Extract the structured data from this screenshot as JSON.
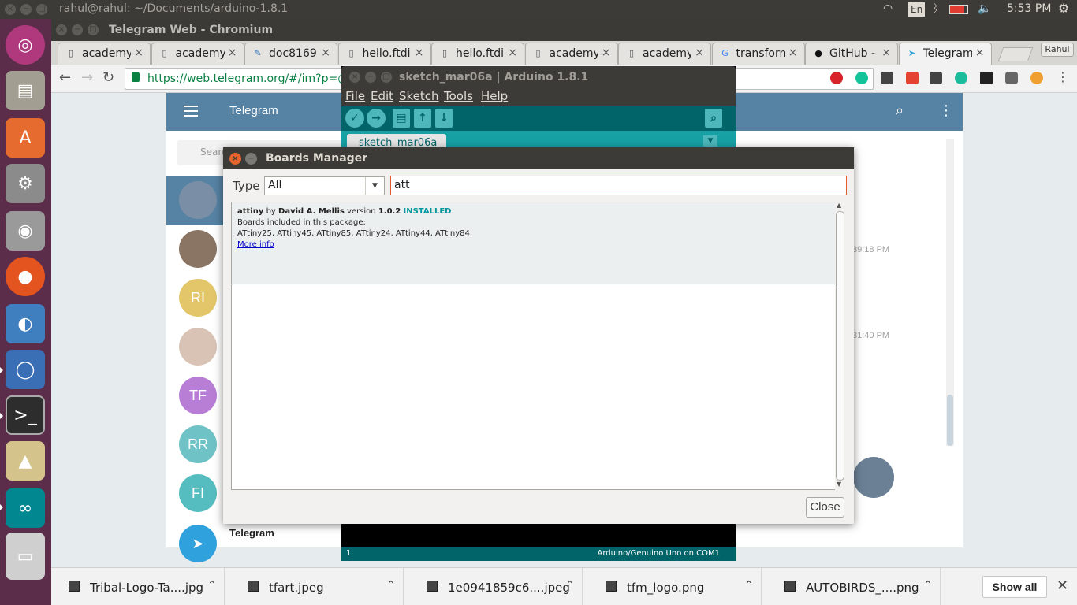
{
  "os": {
    "window_title": "rahul@rahul: ~/Documents/arduino-1.8.1",
    "keyboard": "En",
    "clock": "5:53 PM"
  },
  "browser": {
    "window_title": "Telegram Web - Chromium",
    "tabs": [
      {
        "label": "academy",
        "icon": "doc"
      },
      {
        "label": "academy",
        "icon": "doc"
      },
      {
        "label": "doc8169",
        "icon": "pen"
      },
      {
        "label": "hello.ftdi",
        "icon": "doc"
      },
      {
        "label": "hello.ftdi",
        "icon": "doc"
      },
      {
        "label": "academy",
        "icon": "doc"
      },
      {
        "label": "academy",
        "icon": "doc"
      },
      {
        "label": "transform",
        "icon": "google"
      },
      {
        "label": "GitHub - I",
        "icon": "github"
      },
      {
        "label": "Telegram",
        "icon": "telegram"
      }
    ],
    "profile": "Rahul",
    "url": "https://web.telegram.org/#/im?p=@sci"
  },
  "telegram": {
    "header_title": "Telegram",
    "search_placeholder": "Search",
    "avatars": [
      {
        "initials": "",
        "color": "#7a8fa6"
      },
      {
        "initials": "",
        "color": "#8a7565"
      },
      {
        "initials": "RI",
        "color": "#e3c66a"
      },
      {
        "initials": "",
        "color": "#d9c3b5"
      },
      {
        "initials": "TF",
        "color": "#b87ed6"
      },
      {
        "initials": "RR",
        "color": "#6fc2c6"
      },
      {
        "initials": "FI",
        "color": "#55bdbf"
      }
    ],
    "last_chat_name": "Telegram",
    "timestamp1": "39:18 PM",
    "timestamp2": "31:40 PM"
  },
  "arduino": {
    "window_title": "sketch_mar06a | Arduino 1.8.1",
    "menu": [
      "File",
      "Edit",
      "Sketch",
      "Tools",
      "Help"
    ],
    "tab": "sketch_mar06a",
    "status_line": "1",
    "status_board": "Arduino/Genuino Uno on COM1"
  },
  "boards_manager": {
    "title": "Boards Manager",
    "type_label": "Type",
    "type_value": "All",
    "search_value": "att",
    "entry": {
      "name": "attiny",
      "by": "by",
      "author": "David A. Mellis",
      "version_label": "version",
      "version": "1.0.2",
      "status": "INSTALLED",
      "boards_heading": "Boards included in this package:",
      "boards": "ATtiny25, ATtiny45, ATtiny85, ATtiny24, ATtiny44, ATtiny84.",
      "more_info": "More info"
    },
    "close_label": "Close"
  },
  "downloads": {
    "items": [
      "Tribal-Logo-Ta....jpg",
      "tfart.jpeg",
      "1e0941859c6....jpeg",
      "tfm_logo.png",
      "AUTOBIRDS_....png"
    ],
    "show_all": "Show all"
  }
}
